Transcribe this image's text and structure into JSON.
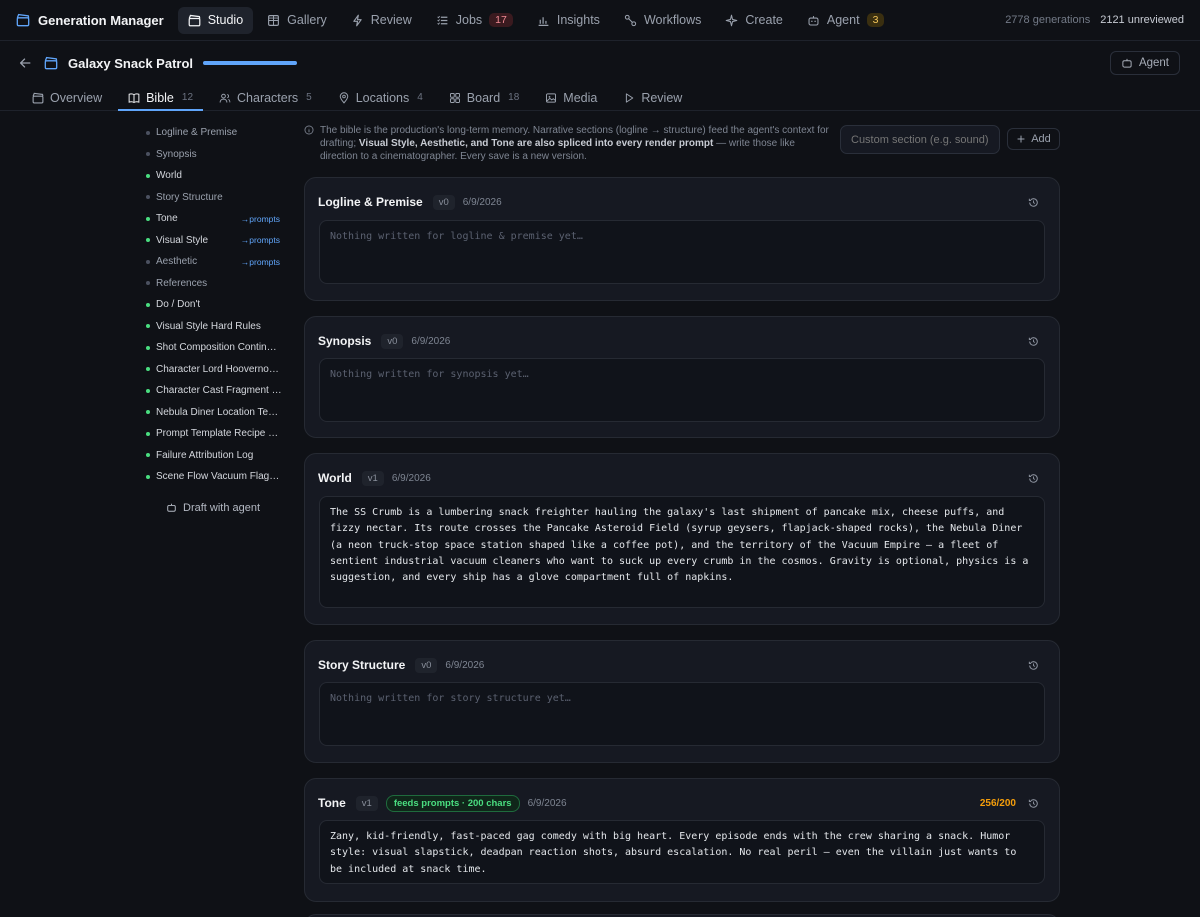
{
  "topnav": {
    "brand": "Generation Manager",
    "items": [
      {
        "label": "Studio",
        "icon": "clapperboard-icon",
        "active": true
      },
      {
        "label": "Gallery",
        "icon": "grid-icon"
      },
      {
        "label": "Review",
        "icon": "lightning-icon"
      },
      {
        "label": "Jobs",
        "icon": "list-icon",
        "badge": "17",
        "badge_color": "#f18a95"
      },
      {
        "label": "Insights",
        "icon": "bar-chart-icon"
      },
      {
        "label": "Workflows",
        "icon": "workflow-icon"
      },
      {
        "label": "Create",
        "icon": "sparkle-icon"
      },
      {
        "label": "Agent",
        "icon": "robot-icon",
        "badge": "3",
        "badge_color": "#f5c65a"
      }
    ],
    "stats": {
      "generations": "2778 generations",
      "unreviewed": "2121 unreviewed"
    }
  },
  "project": {
    "title": "Galaxy Snack Patrol",
    "agent_button": "Agent"
  },
  "tabs": [
    {
      "label": "Overview",
      "icon": "clapperboard-icon",
      "count": ""
    },
    {
      "label": "Bible",
      "icon": "book-icon",
      "count": "12",
      "active": true
    },
    {
      "label": "Characters",
      "icon": "users-icon",
      "count": "5"
    },
    {
      "label": "Locations",
      "icon": "pin-icon",
      "count": "4"
    },
    {
      "label": "Board",
      "icon": "grid-icon",
      "count": "18"
    },
    {
      "label": "Media",
      "icon": "image-icon",
      "count": ""
    },
    {
      "label": "Review",
      "icon": "play-icon",
      "count": ""
    }
  ],
  "sidebar": {
    "items": [
      {
        "label": "Logline & Premise",
        "filled": false,
        "prompts": ""
      },
      {
        "label": "Synopsis",
        "filled": false,
        "prompts": ""
      },
      {
        "label": "World",
        "filled": true,
        "prompts": ""
      },
      {
        "label": "Story Structure",
        "filled": false,
        "prompts": ""
      },
      {
        "label": "Tone",
        "filled": true,
        "prompts": "→prompts"
      },
      {
        "label": "Visual Style",
        "filled": true,
        "prompts": "→prompts"
      },
      {
        "label": "Aesthetic",
        "filled": false,
        "prompts": "→prompts"
      },
      {
        "label": "References",
        "filled": false,
        "prompts": ""
      },
      {
        "label": "Do / Don't",
        "filled": true,
        "prompts": ""
      },
      {
        "label": "Visual Style Hard Rules",
        "filled": true,
        "prompts": ""
      },
      {
        "label": "Shot Composition Continui…",
        "filled": true,
        "prompts": ""
      },
      {
        "label": "Character Lord Hoovernox…",
        "filled": true,
        "prompts": ""
      },
      {
        "label": "Character Cast Fragment …",
        "filled": true,
        "prompts": ""
      },
      {
        "label": "Nebula Diner Location Te…",
        "filled": true,
        "prompts": ""
      },
      {
        "label": "Prompt Template Recipe L…",
        "filled": true,
        "prompts": ""
      },
      {
        "label": "Failure Attribution Log",
        "filled": true,
        "prompts": ""
      },
      {
        "label": "Scene Flow Vacuum Flags…",
        "filled": true,
        "prompts": ""
      }
    ],
    "draft_button": "Draft with agent"
  },
  "info": {
    "text_1": "The bible is the production's long-term memory. Narrative sections (logline → structure) feed the agent's context for drafting; ",
    "bold": "Visual Style, Aesthetic, and Tone are also spliced into every render prompt",
    "text_2": " — write those like direction to a cinematographer. Every save is a new version."
  },
  "custom_section": {
    "placeholder": "Custom section (e.g. sound)…",
    "add_label": "Add"
  },
  "cards": [
    {
      "title": "Logline & Premise",
      "version": "v0",
      "date": "6/9/2026",
      "empty": true,
      "text": "Nothing written for logline & premise yet…"
    },
    {
      "title": "Synopsis",
      "version": "v0",
      "date": "6/9/2026",
      "empty": true,
      "text": "Nothing written for synopsis yet…"
    },
    {
      "title": "World",
      "version": "v1",
      "date": "6/9/2026",
      "empty": false,
      "text": "The SS Crumb is a lumbering snack freighter hauling the galaxy's last shipment of pancake mix, cheese puffs, and fizzy nectar. Its route crosses the Pancake Asteroid Field (syrup geysers, flapjack-shaped rocks), the Nebula Diner (a neon truck-stop space station shaped like a coffee pot), and the territory of the Vacuum Empire — a fleet of sentient industrial vacuum cleaners who want to suck up every crumb in the cosmos. Gravity is optional, physics is a suggestion, and every ship has a glove compartment full of napkins."
    },
    {
      "title": "Story Structure",
      "version": "v0",
      "date": "6/9/2026",
      "empty": true,
      "text": "Nothing written for story structure yet…"
    },
    {
      "title": "Tone",
      "version": "v1",
      "date": "6/9/2026",
      "empty": false,
      "feeds": "feeds prompts · 200 chars",
      "chars": "256/200",
      "text": "Zany, kid-friendly, fast-paced gag comedy with big heart. Every episode ends with the crew sharing a snack. Humor style: visual slapstick, deadpan reaction shots, absurd escalation. No real peril — even the villain just wants to be included at snack time."
    }
  ]
}
